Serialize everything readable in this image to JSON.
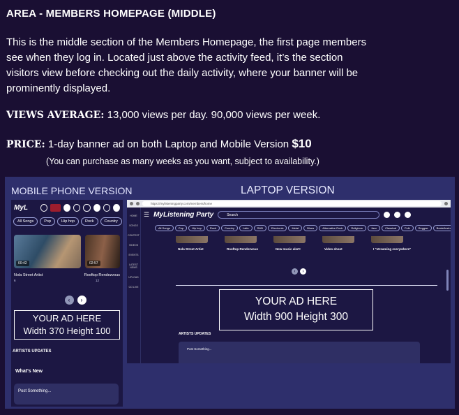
{
  "heading": "AREA - MEMBERS HOMEPAGE (MIDDLE)",
  "description": "This is the middle section of the Members Homepage, the first page members see when they log in. Located just above the activity feed, it’s the section visitors view before checking out the daily activity, where your banner will be prominently displayed.",
  "views": {
    "label": "VIEWS AVERAGE:",
    "value": "13,000 views per day. 90,000 views per week."
  },
  "price": {
    "label": "PRICE:",
    "text": "1-day banner ad on both Laptop and Mobile Version",
    "amount": "$10",
    "note": "(You can purchase as many weeks as you want, subject to availability.)"
  },
  "panel": {
    "mobile_title": "MOBILE PHONE VERSION",
    "laptop_title": "LAPTOP VERSION"
  },
  "mobile": {
    "logo": "MyL",
    "chips": [
      "All Songs",
      "Pop",
      "Hip hop",
      "Rock",
      "Country"
    ],
    "thumbs": [
      {
        "duration": "00:42",
        "title": "Nola Street Artist",
        "likes": "6"
      },
      {
        "duration": "02:57",
        "title": "Rooftop Rendezvous",
        "likes": "12"
      }
    ],
    "ad_line1": "YOUR AD HERE",
    "ad_line2": "Width 370 Height 100",
    "artists_updates": "ARTISTS UPDATES",
    "whats_new": "What's New",
    "post_placeholder": "Post Something..."
  },
  "laptop": {
    "url": "https://mylisteningparty.com/members/home",
    "logo": "MyListening Party",
    "search_placeholder": "Search",
    "chips": [
      "All Songs",
      "Pop",
      "Hip hop",
      "Rock",
      "Country",
      "Latin",
      "R&B",
      "Electronic",
      "Metal",
      "Blues",
      "Alternative Rock",
      "Religious",
      "Jazz",
      "Classical",
      "Folk",
      "Reggae",
      "Beats/Instrumen"
    ],
    "captions": [
      "Nola Street Artist",
      "Rooftop Rendezvous",
      "New music alert!",
      "Video shoot",
      "I \"streaming everywhere\""
    ],
    "sidebar": [
      "HOME",
      "SONGS",
      "CONTEST",
      "VIDEOS",
      "EVENTS",
      "LATEST NEWS",
      "UPLOAD",
      "GO LIVE"
    ],
    "ad_line1": "YOUR AD HERE",
    "ad_line2": "Width 900 Height 300",
    "artists_updates": "ARTISTS UPDATES",
    "post_placeholder": "Post Something..."
  }
}
